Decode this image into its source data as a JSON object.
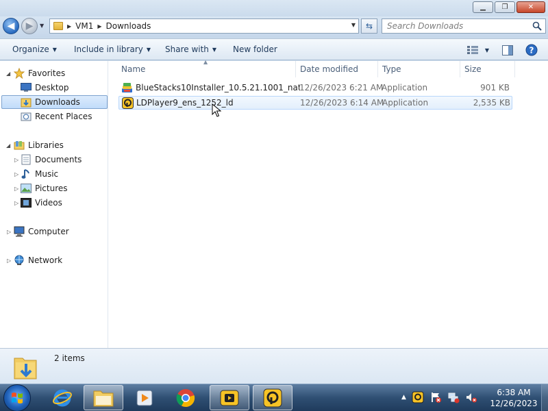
{
  "window": {
    "minimize_glyph": "▁",
    "maximize_glyph": "❐",
    "close_glyph": "✕"
  },
  "address": {
    "crumbs": [
      "VM1",
      "Downloads"
    ],
    "search_placeholder": "Search Downloads"
  },
  "toolbar": {
    "organize": "Organize",
    "include_in_library": "Include in library",
    "share_with": "Share with",
    "new_folder": "New folder"
  },
  "nav": {
    "favorites": "Favorites",
    "desktop": "Desktop",
    "downloads": "Downloads",
    "recent_places": "Recent Places",
    "libraries": "Libraries",
    "documents": "Documents",
    "music": "Music",
    "pictures": "Pictures",
    "videos": "Videos",
    "computer": "Computer",
    "network": "Network"
  },
  "columns": {
    "name": "Name",
    "date_modified": "Date modified",
    "type": "Type",
    "size": "Size"
  },
  "files": [
    {
      "name": "BlueStacks10Installer_10.5.21.1001_native...",
      "date": "12/26/2023 6:21 AM",
      "type": "Application",
      "size": "901 KB",
      "icon": "bluestacks-icon"
    },
    {
      "name": "LDPlayer9_ens_1252_ld",
      "date": "12/26/2023 6:14 AM",
      "type": "Application",
      "size": "2,535 KB",
      "icon": "ldplayer-icon"
    }
  ],
  "details": {
    "count": "2 items"
  },
  "taskbar": {
    "time": "6:38 AM",
    "date": "12/26/2023"
  },
  "colors": {
    "selection": "#c1dcfa",
    "taskbar": "#2f4f73",
    "accent": "#1e395b"
  }
}
